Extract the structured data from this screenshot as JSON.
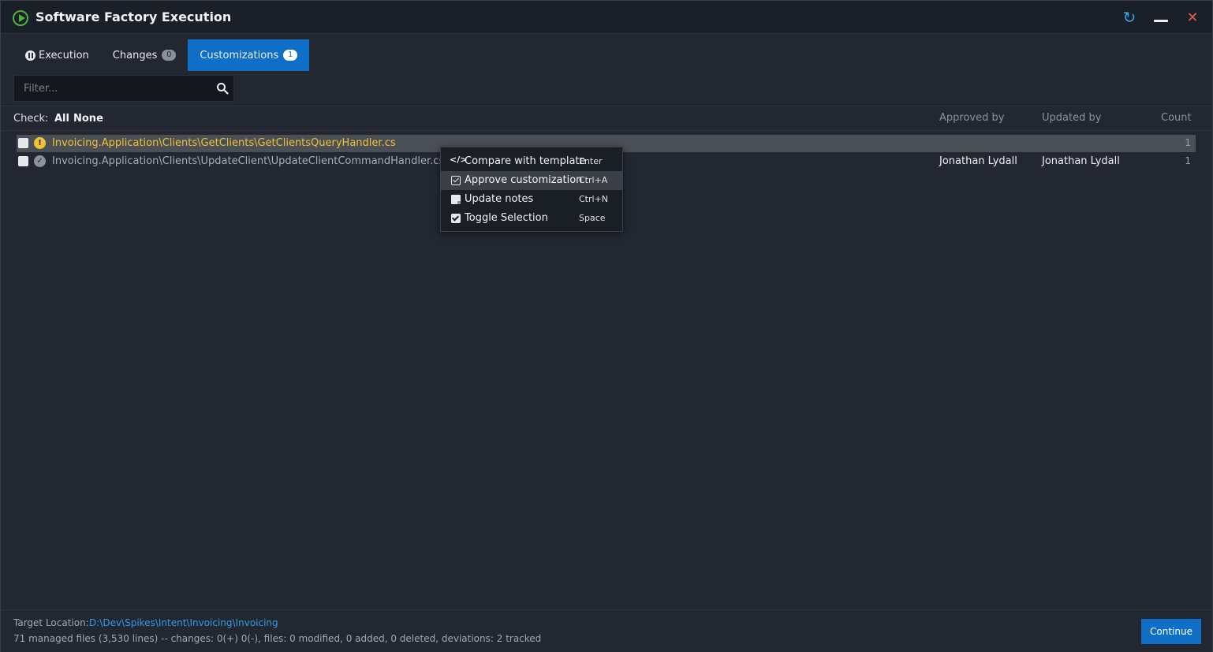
{
  "window": {
    "title": "Software Factory Execution"
  },
  "titlebar": {
    "refresh_icon": "refresh-icon",
    "minimize_icon": "minimize-icon",
    "close_icon": "close-icon"
  },
  "tabs": [
    {
      "label": "Execution",
      "icon": "pause-circle-icon"
    },
    {
      "label": "Changes",
      "badge": "0"
    },
    {
      "label": "Customizations",
      "badge": "1",
      "active": true
    }
  ],
  "filter": {
    "placeholder": "Filter...",
    "value": ""
  },
  "check": {
    "label": "Check:",
    "all": "All",
    "none": "None"
  },
  "columns": {
    "approved_by": "Approved by",
    "updated_by": "Updated by",
    "count": "Count"
  },
  "rows": [
    {
      "status": "warning",
      "path": "Invoicing.Application\\Clients\\GetClients\\GetClientsQueryHandler.cs",
      "approved_by": "",
      "updated_by": "",
      "count": "1",
      "selected": true
    },
    {
      "status": "approved",
      "path": "Invoicing.Application\\Clients\\UpdateClient\\UpdateClientCommandHandler.cs",
      "approved_by": "Jonathan Lydall",
      "updated_by": "Jonathan Lydall",
      "count": "1",
      "selected": false
    }
  ],
  "context_menu": [
    {
      "label": "Compare with template",
      "shortcut": "Enter",
      "icon": "code-icon"
    },
    {
      "label": "Approve customization",
      "shortcut": "Ctrl+A",
      "icon": "approve-check-icon",
      "highlighted": true
    },
    {
      "label": "Update notes",
      "shortcut": "Ctrl+N",
      "icon": "note-icon"
    },
    {
      "label": "Toggle Selection",
      "shortcut": "Space",
      "icon": "checkbox-icon"
    }
  ],
  "footer": {
    "target_label": "Target Location:",
    "target_path": "D:\\Dev\\Spikes\\Intent\\Invoicing\\Invoicing",
    "summary": "71 managed files (3,530 lines) -- changes: 0(+) 0(-), files: 0 modified, 0 added, 0 deleted, deviations: 2 tracked",
    "continue_label": "Continue"
  },
  "colors": {
    "accent": "#0f6fc6",
    "warning": "#f3c12f",
    "link": "#2f9ee6",
    "background": "#222731"
  }
}
